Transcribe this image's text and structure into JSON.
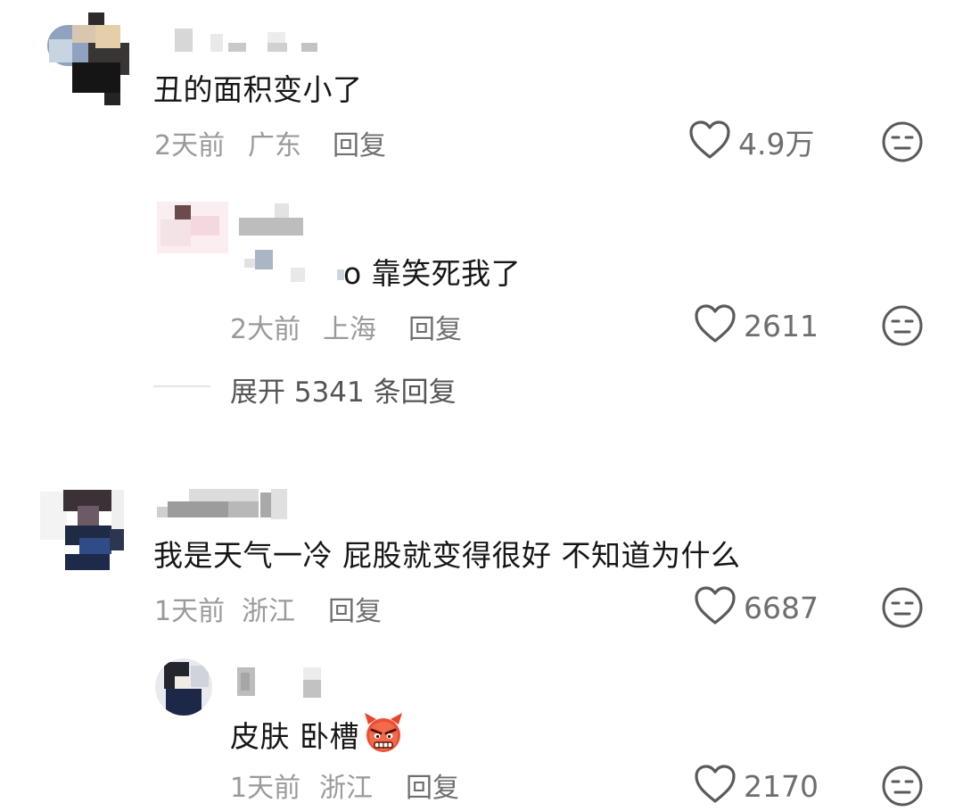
{
  "comments": [
    {
      "text": "丑的面积变小了",
      "time": "2天前",
      "location": "广东",
      "reply_label": "回复",
      "likes": "4.9万",
      "replies": [
        {
          "text": "o 靠笑死我了",
          "time": "2大前",
          "location": "上海",
          "reply_label": "回复",
          "likes": "2611"
        }
      ],
      "expand_label": "展开 5341 条回复"
    },
    {
      "text": "我是天气一冷 屁股就变得很好 不知道为什么",
      "time": "1天前",
      "location": "浙江",
      "reply_label": "回复",
      "likes": "6687",
      "replies": [
        {
          "text": "皮肤 卧槽",
          "emoji": "angry-devil-emoji",
          "time": "1天前",
          "location": "浙江",
          "reply_label": "回复",
          "likes": "2170"
        }
      ]
    }
  ],
  "icons": {
    "like": "heart-outline-icon",
    "dislike": "expressionless-face-icon"
  },
  "colors": {
    "text": "#161616",
    "meta": "#9a9a9a",
    "icon": "#5a5a5a",
    "emoji": "#e8452f"
  }
}
